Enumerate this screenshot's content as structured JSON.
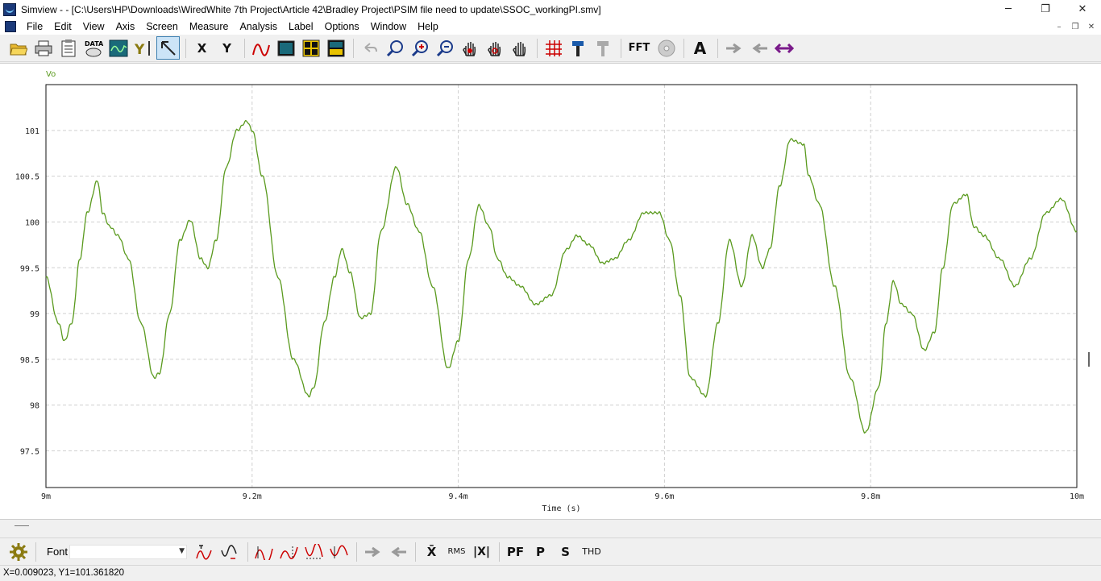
{
  "window": {
    "title": "Simview -  - [C:\\Users\\HP\\Downloads\\WiredWhite 7th Project\\Article 42\\Bradley Project\\PSIM file need to update\\SSOC_workingPI.smv]",
    "controls": {
      "minimize": "─",
      "maximize": "❐",
      "close": "✕"
    }
  },
  "menubar": {
    "items": [
      "File",
      "Edit",
      "View",
      "Axis",
      "Screen",
      "Measure",
      "Analysis",
      "Label",
      "Options",
      "Window",
      "Help"
    ],
    "mdi_controls": [
      "–",
      "❐",
      "✕"
    ]
  },
  "toolbar": {
    "data_label": "DATA",
    "x_label": "X",
    "y_label": "Y",
    "fft_label": "FFT",
    "text_label": "A",
    "yi_label": "Y"
  },
  "toolbar2": {
    "font_label": "Font",
    "font_value": "",
    "mean_label": "X̄",
    "rms_label": "RMS",
    "abs_label": "|X|",
    "pf_label": "PF",
    "p_label": "P",
    "s_label": "S",
    "thd_label": "THD"
  },
  "status": {
    "text": "X=0.009023, Y1=101.361820"
  },
  "colors": {
    "trace": "#5a9a1e",
    "legend": "#5a9a1e",
    "grid": "#d0d0d0"
  },
  "chart_data": {
    "type": "line",
    "xlabel": "Time (s)",
    "ylabel": "",
    "x_tick_labels": [
      "9m",
      "9.2m",
      "9.4m",
      "9.6m",
      "9.8m",
      "10m"
    ],
    "x_ticks": [
      0.009,
      0.0092,
      0.0094,
      0.0096,
      0.0098,
      0.01
    ],
    "y_tick_labels": [
      "97.5",
      "98",
      "98.5",
      "99",
      "99.5",
      "100",
      "100.5",
      "101"
    ],
    "y_ticks": [
      97.5,
      98,
      98.5,
      99,
      99.5,
      100,
      100.5,
      101
    ],
    "xlim": [
      0.009,
      0.01
    ],
    "ylim": [
      97.1,
      101.5
    ],
    "grid": true,
    "series": [
      {
        "name": "Vo",
        "x": [
          0.009,
          0.009012,
          0.009018,
          0.009025,
          0.009033,
          0.00904,
          0.00905,
          0.009055,
          0.009062,
          0.00907,
          0.00908,
          0.009092,
          0.009105,
          0.00911,
          0.00912,
          0.00913,
          0.00914,
          0.00915,
          0.009157,
          0.009165,
          0.009175,
          0.009185,
          0.009195,
          0.0092,
          0.00921,
          0.009225,
          0.00924,
          0.009255,
          0.00926,
          0.00927,
          0.00928,
          0.009287,
          0.009295,
          0.009305,
          0.009315,
          0.009325,
          0.00934,
          0.00935,
          0.009362,
          0.009375,
          0.00939,
          0.0094,
          0.00941,
          0.00942,
          0.00943,
          0.009438,
          0.009448,
          0.00946,
          0.009475,
          0.00949,
          0.009505,
          0.009515,
          0.009527,
          0.00954,
          0.009552,
          0.009565,
          0.00958,
          0.009595,
          0.009605,
          0.009615,
          0.009625,
          0.00964,
          0.009652,
          0.009663,
          0.009675,
          0.009685,
          0.009695,
          0.009702,
          0.009712,
          0.009722,
          0.009735,
          0.00974,
          0.00975,
          0.009765,
          0.00978,
          0.009795,
          0.009808,
          0.009815,
          0.009822,
          0.00983,
          0.00984,
          0.009852,
          0.009862,
          0.00987,
          0.00988,
          0.009893,
          0.0099,
          0.00991,
          0.009925,
          0.00994,
          0.009955,
          0.00997,
          0.009985,
          0.01
        ],
        "y": [
          99.4,
          98.9,
          98.7,
          98.9,
          99.6,
          100.1,
          100.45,
          100.1,
          99.95,
          99.85,
          99.6,
          98.9,
          98.3,
          98.35,
          99.0,
          99.8,
          100.02,
          99.6,
          99.5,
          99.8,
          100.6,
          101.0,
          101.1,
          101.0,
          100.5,
          99.4,
          98.5,
          98.1,
          98.2,
          98.9,
          99.4,
          99.7,
          99.45,
          98.95,
          99.0,
          99.9,
          100.6,
          100.2,
          99.9,
          99.3,
          98.4,
          98.7,
          99.6,
          100.18,
          99.95,
          99.6,
          99.4,
          99.3,
          99.1,
          99.2,
          99.7,
          99.85,
          99.75,
          99.55,
          99.6,
          99.8,
          100.1,
          100.1,
          99.8,
          99.2,
          98.3,
          98.1,
          98.9,
          99.8,
          99.3,
          99.85,
          99.5,
          99.7,
          100.4,
          100.9,
          100.85,
          100.5,
          100.2,
          99.3,
          98.3,
          97.7,
          98.2,
          98.9,
          99.35,
          99.1,
          99.0,
          98.6,
          98.8,
          99.5,
          100.2,
          100.3,
          99.95,
          99.85,
          99.6,
          99.3,
          99.6,
          100.1,
          100.25,
          99.9
        ]
      }
    ],
    "legend_position": "top-left"
  }
}
